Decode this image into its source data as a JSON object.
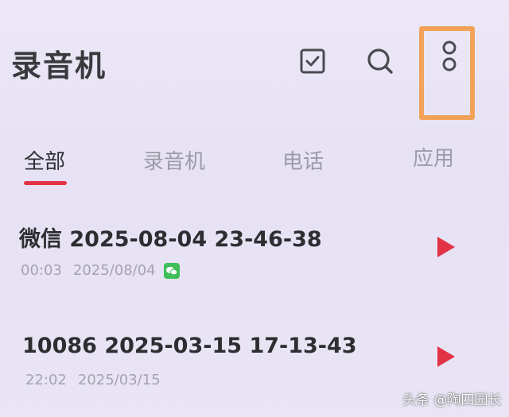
{
  "header": {
    "title": "录音机",
    "icons": {
      "select": "checkbox-icon",
      "search": "search-icon",
      "more": "more-vertical-icon"
    },
    "highlight_color": "#f2a358"
  },
  "tabs": [
    {
      "label": "全部",
      "active": true
    },
    {
      "label": "录音机",
      "active": false
    },
    {
      "label": "电话",
      "active": false
    },
    {
      "label": "应用",
      "active": false
    }
  ],
  "accent_color": "#e23346",
  "recordings": [
    {
      "title": "微信  2025-08-04 23-46-38",
      "duration": "00:03",
      "date": "2025/08/04",
      "source_icon": "wechat-icon"
    },
    {
      "title": "10086 2025-03-15 17-13-43",
      "duration": "22:02",
      "date": "2025/03/15",
      "source_icon": ""
    }
  ],
  "watermark": "头条 @陶四园长"
}
